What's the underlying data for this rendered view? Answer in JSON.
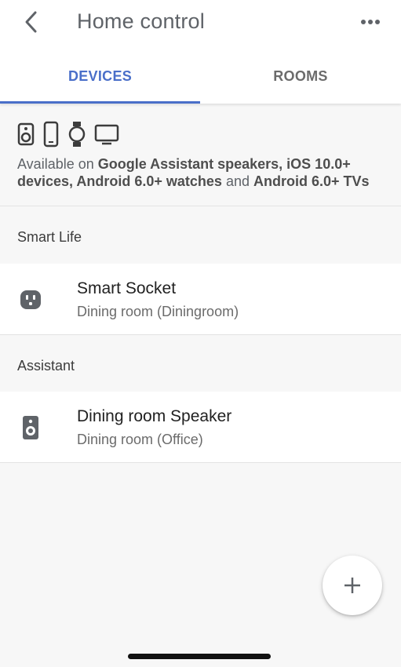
{
  "header": {
    "title": "Home control",
    "back_icon": "chevron-left-icon",
    "more_icon": "more-horizontal-icon"
  },
  "tabs": [
    {
      "label": "DEVICES",
      "selected": true
    },
    {
      "label": "ROOMS",
      "selected": false
    }
  ],
  "availability": {
    "icons": [
      "speaker-icon",
      "phone-icon",
      "watch-icon",
      "tv-icon"
    ],
    "prefix": "Available on ",
    "part1": "Google Assistant speakers, iOS 10.0+ devices, Android 6.0+ watches",
    "middle": " and ",
    "part2": "Android 6.0+ TVs"
  },
  "sections": [
    {
      "header": "Smart Life",
      "devices": [
        {
          "icon": "outlet-icon",
          "name": "Smart Socket",
          "room": "Dining room (Diningroom)"
        }
      ]
    },
    {
      "header": "Assistant",
      "devices": [
        {
          "icon": "speaker-icon",
          "name": "Dining room Speaker",
          "room": "Dining room (Office)"
        }
      ]
    }
  ],
  "fab": {
    "icon": "plus-icon"
  },
  "colors": {
    "accent": "#4a6fc9",
    "background": "#f7f7f7",
    "card": "#ffffff"
  }
}
